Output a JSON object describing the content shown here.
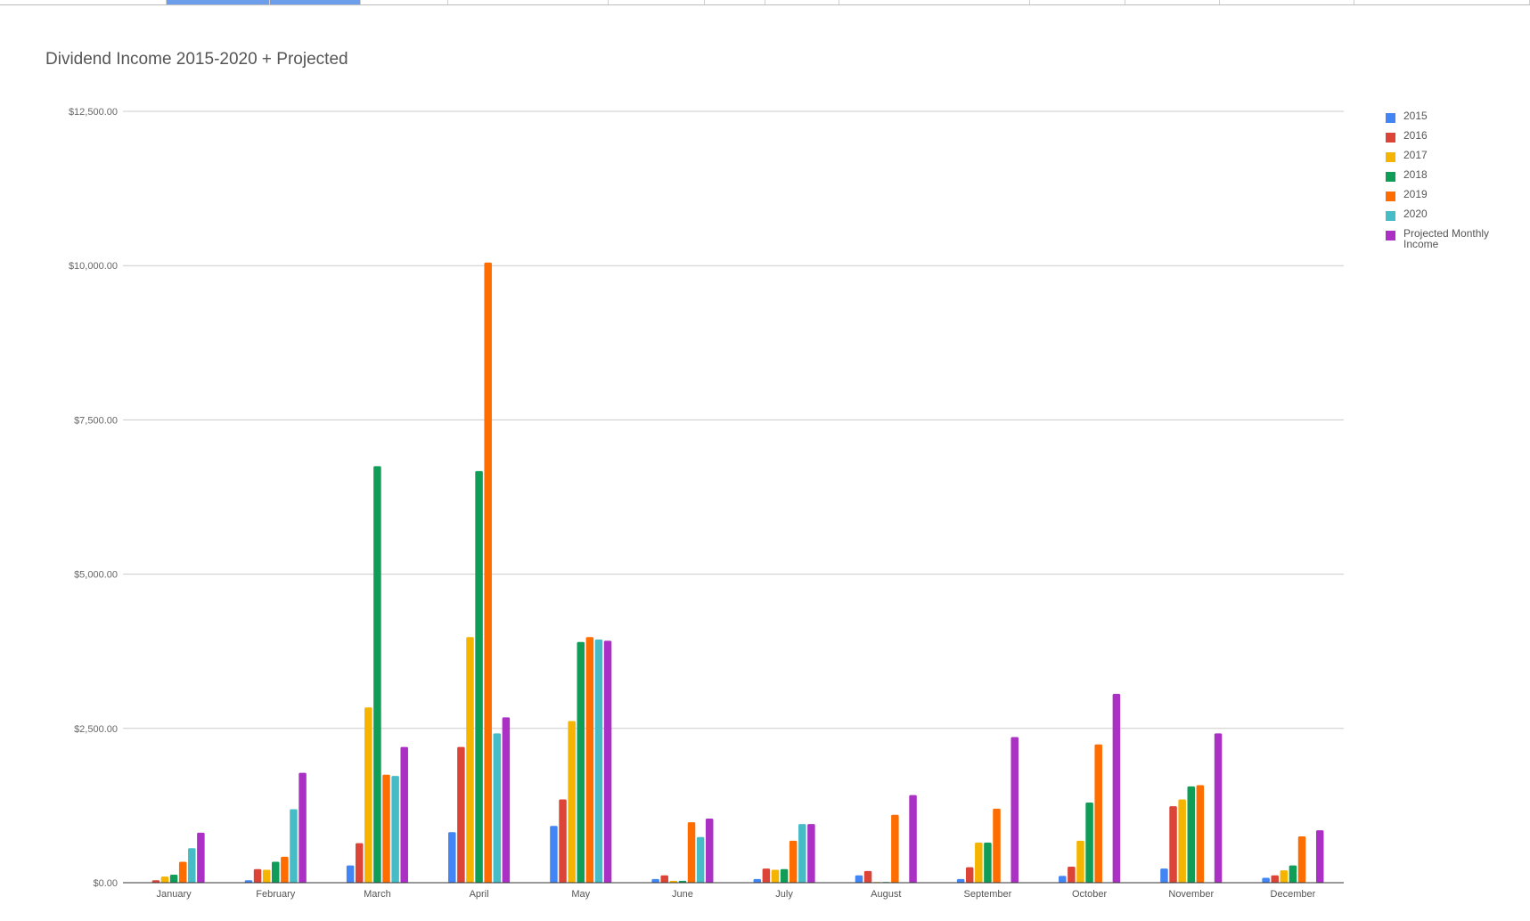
{
  "chart_data": {
    "type": "bar",
    "title": "Dividend Income 2015-2020 + Projected",
    "xlabel": "",
    "ylabel": "",
    "ylim": [
      0,
      12500
    ],
    "yticks": [
      {
        "value": 0,
        "label": "$0.00"
      },
      {
        "value": 2500,
        "label": "$2,500.00"
      },
      {
        "value": 5000,
        "label": "$5,000.00"
      },
      {
        "value": 7500,
        "label": "$7,500.00"
      },
      {
        "value": 10000,
        "label": "$10,000.00"
      },
      {
        "value": 12500,
        "label": "$12,500.00"
      }
    ],
    "grid": true,
    "legend": "right",
    "categories": [
      "January",
      "February",
      "March",
      "April",
      "May",
      "June",
      "July",
      "August",
      "September",
      "October",
      "November",
      "December"
    ],
    "series": [
      {
        "name": "2015",
        "color": "#4285f4",
        "values": [
          0,
          40,
          280,
          820,
          920,
          60,
          60,
          120,
          60,
          110,
          230,
          80
        ]
      },
      {
        "name": "2016",
        "color": "#db4437",
        "values": [
          40,
          220,
          640,
          2200,
          1350,
          120,
          230,
          190,
          250,
          260,
          1240,
          120
        ]
      },
      {
        "name": "2017",
        "color": "#f4b400",
        "values": [
          100,
          210,
          2840,
          3980,
          2620,
          30,
          210,
          10,
          650,
          680,
          1350,
          200
        ]
      },
      {
        "name": "2018",
        "color": "#0f9d58",
        "values": [
          130,
          340,
          6750,
          6670,
          3900,
          30,
          220,
          10,
          650,
          1300,
          1560,
          280
        ]
      },
      {
        "name": "2019",
        "color": "#ff6d00",
        "values": [
          340,
          420,
          1750,
          10050,
          3980,
          980,
          680,
          1100,
          1200,
          2240,
          1580,
          750
        ]
      },
      {
        "name": "2020",
        "color": "#46bdc6",
        "values": [
          560,
          1190,
          1730,
          2420,
          3940,
          740,
          950,
          0,
          0,
          0,
          0,
          0
        ]
      },
      {
        "name": "Projected Monthly Income",
        "color": "#ab30c4",
        "values": [
          810,
          1780,
          2200,
          2680,
          3920,
          1040,
          950,
          1420,
          2360,
          3060,
          2420,
          850
        ]
      }
    ]
  }
}
